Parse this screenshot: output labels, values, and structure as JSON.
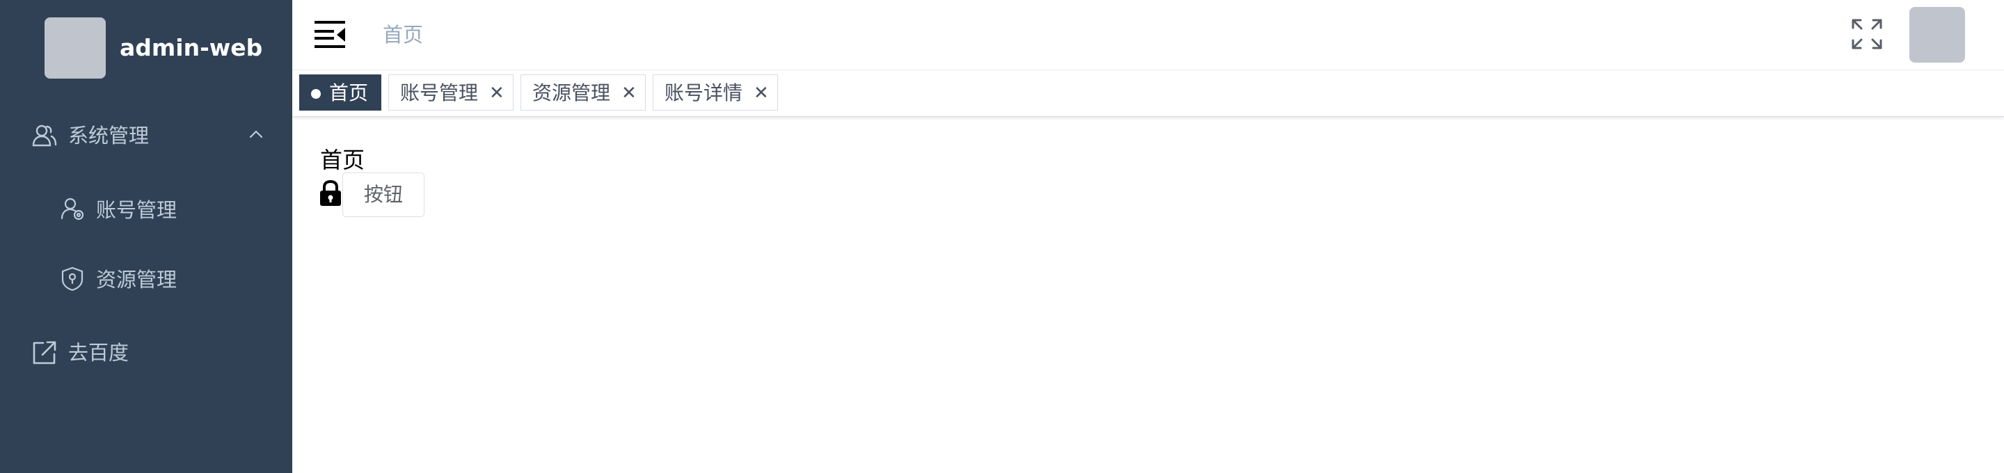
{
  "app": {
    "title": "admin-web"
  },
  "sidebar": {
    "items": [
      {
        "label": "系统管理",
        "icon": "user-group-icon",
        "expanded": true
      },
      {
        "label": "账号管理",
        "icon": "user-settings-icon"
      },
      {
        "label": "资源管理",
        "icon": "shield-icon"
      },
      {
        "label": "去百度",
        "icon": "external-link-icon"
      }
    ]
  },
  "navbar": {
    "breadcrumb": "首页"
  },
  "tags": [
    {
      "label": "首页",
      "active": true
    },
    {
      "label": "账号管理",
      "close": "✕"
    },
    {
      "label": "资源管理",
      "close": "✕"
    },
    {
      "label": "账号详情",
      "close": "✕"
    }
  ],
  "content": {
    "title": "首页",
    "button_label": "按钮"
  },
  "colors": {
    "sidebar_bg": "#304156",
    "sidebar_text": "#bfcbd9",
    "active_tag": "#304156",
    "breadcrumb": "#97a8be"
  }
}
